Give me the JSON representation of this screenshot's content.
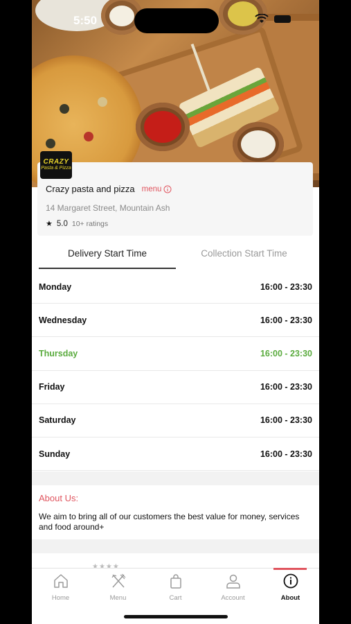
{
  "status_bar": {
    "time": "5:50"
  },
  "restaurant": {
    "logo_line1": "CRAZY",
    "logo_line2": "Pasta & Pizza",
    "name": "Crazy pasta and pizza",
    "menu_link": "menu",
    "address": "14 Margaret Street, Mountain Ash",
    "rating": "5.0",
    "ratings_count": "10+ ratings"
  },
  "tabs": {
    "delivery": "Delivery Start Time",
    "collection": "Collection Start Time"
  },
  "hours": [
    {
      "day": "Monday",
      "time": "16:00 - 23:30"
    },
    {
      "day": "Wednesday",
      "time": "16:00 - 23:30"
    },
    {
      "day": "Thursday",
      "time": "16:00 - 23:30"
    },
    {
      "day": "Friday",
      "time": "16:00 - 23:30"
    },
    {
      "day": "Saturday",
      "time": "16:00 - 23:30"
    },
    {
      "day": "Sunday",
      "time": "16:00 - 23:30"
    }
  ],
  "about": {
    "title": "About Us:",
    "text": "We aim to bring all of our customers the best value for money, services and food around+"
  },
  "nav": {
    "home": "Home",
    "menu": "Menu",
    "cart": "Cart",
    "account": "Account",
    "about": "About"
  },
  "colors": {
    "accent": "#e0555f",
    "today": "#5aab3e"
  }
}
